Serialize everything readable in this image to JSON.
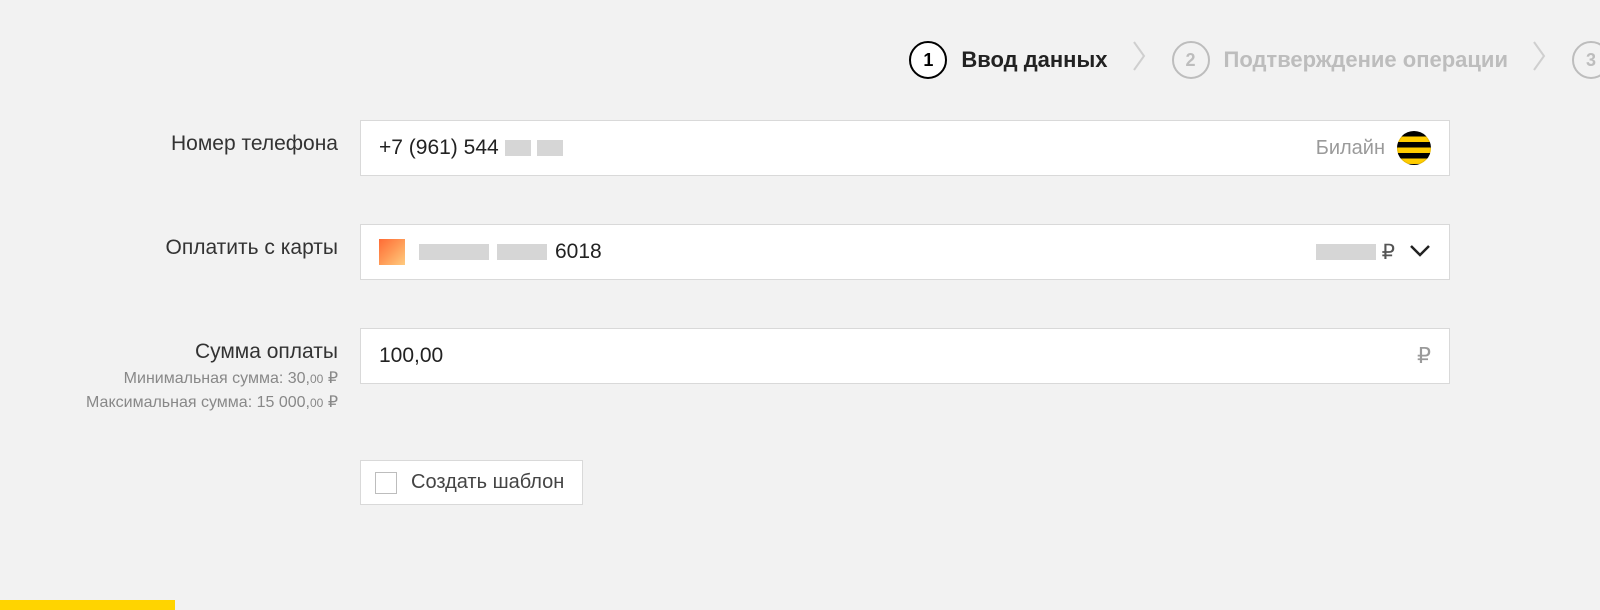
{
  "stepper": {
    "step1": {
      "num": "1",
      "label": "Ввод данных"
    },
    "step2": {
      "num": "2",
      "label": "Подтверждение операции"
    },
    "step3": {
      "num": "3"
    }
  },
  "phone": {
    "label": "Номер телефона",
    "value_prefix": "+7 (961) 544",
    "operator_name": "Билайн"
  },
  "card": {
    "label": "Оплатить с карты",
    "last4": "6018",
    "currency": "₽"
  },
  "amount": {
    "label": "Сумма оплаты",
    "value": "100,00",
    "currency": "₽",
    "hint_min_label": "Минимальная сумма:",
    "hint_min_value": "30,",
    "hint_min_dec": "00",
    "hint_max_label": "Максимальная сумма:",
    "hint_max_value": "15 000,",
    "hint_max_dec": "00",
    "hint_currency": "₽"
  },
  "template": {
    "label": "Создать шаблон"
  }
}
